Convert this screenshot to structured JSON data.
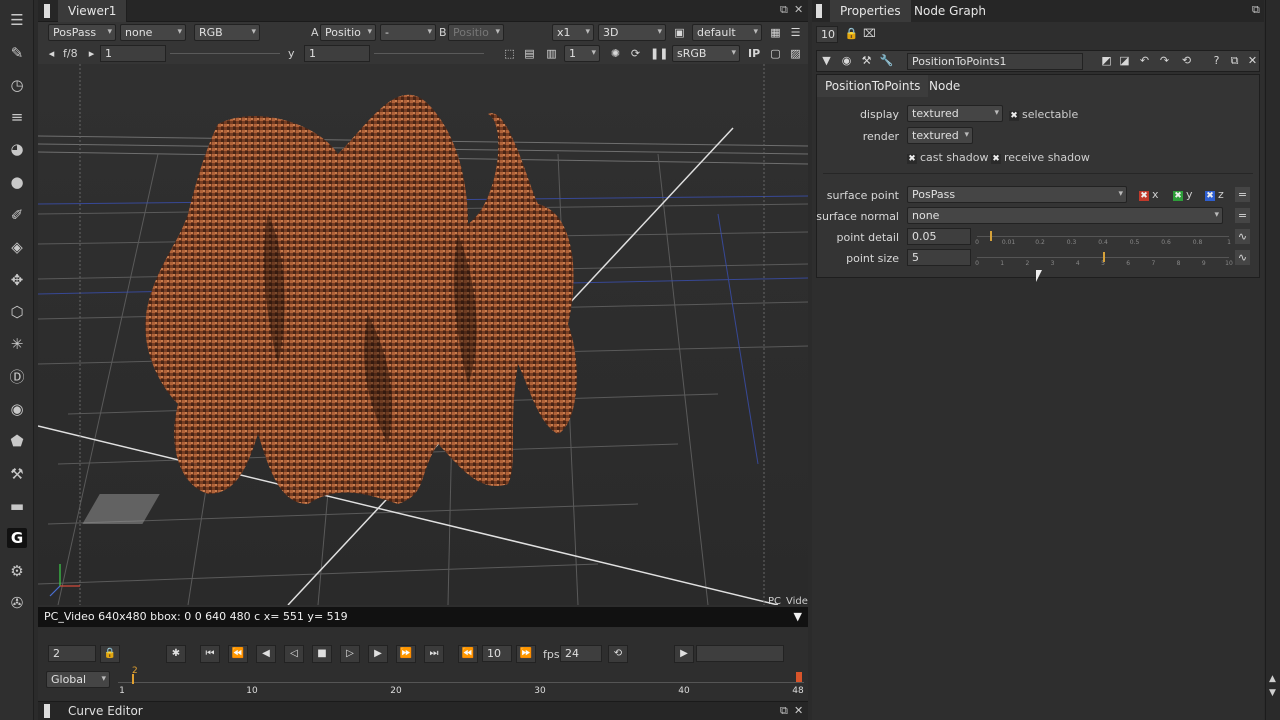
{
  "viewer": {
    "tab_title": "Viewer1",
    "row1": {
      "layer": "PosPass",
      "channel_mask": "none",
      "color_channels": "RGB",
      "a_label": "A",
      "a_input": "Positio",
      "op": "-",
      "b_label": "B",
      "b_input": "Positio",
      "zoom": "x1",
      "view_mode": "3D",
      "camera": "default"
    },
    "row2": {
      "fstop": "f/8",
      "gain": "1",
      "gamma_label": "y",
      "gamma": "1",
      "proxy": "1",
      "colorspace": "sRGB",
      "ip_label": "IP"
    },
    "overlay_corner_text": "PC_Vide",
    "info_text": "PC_Video 640x480 bbox: 0 0 640 480 c  x= 551 y= 519",
    "timeline": {
      "current_frame": "2",
      "increment": "10",
      "fps_label": "fps",
      "fps": "24",
      "scope": "Global",
      "ruler_labels": [
        "1",
        "10",
        "20",
        "30",
        "40",
        "48"
      ],
      "playhead_label": "2"
    },
    "curve_editor_tab": "Curve Editor"
  },
  "properties": {
    "tabs": [
      "Properties",
      "Node Graph"
    ],
    "max_panels": "10",
    "node_name": "PositionToPoints1",
    "node_tabs": [
      "PositionToPoints",
      "Node"
    ],
    "display": {
      "label": "display",
      "value": "textured",
      "selectable_label": "selectable"
    },
    "render": {
      "label": "render",
      "value": "textured"
    },
    "cast_shadow_label": "cast shadow",
    "receive_shadow_label": "receive shadow",
    "surface_point": {
      "label": "surface point",
      "value": "PosPass",
      "x": "x",
      "y": "y",
      "z": "z"
    },
    "surface_normal": {
      "label": "surface normal",
      "value": "none"
    },
    "point_detail": {
      "label": "point detail",
      "value": "0.05",
      "ticks": [
        "0",
        "0.01",
        "0.2",
        "0.3",
        "0.4",
        "0.5",
        "0.6",
        "0.8",
        "1"
      ],
      "fraction": 0.05
    },
    "point_size": {
      "label": "point size",
      "value": "5",
      "ticks": [
        "0",
        "1",
        "2",
        "3",
        "4",
        "5",
        "6",
        "7",
        "8",
        "9",
        "10"
      ],
      "fraction": 0.5
    }
  },
  "colors": {
    "accent_orange": "#d6a23a",
    "check_red": "#c0392b",
    "check_green": "#2e9e3a",
    "check_blue": "#2f5fd0"
  }
}
